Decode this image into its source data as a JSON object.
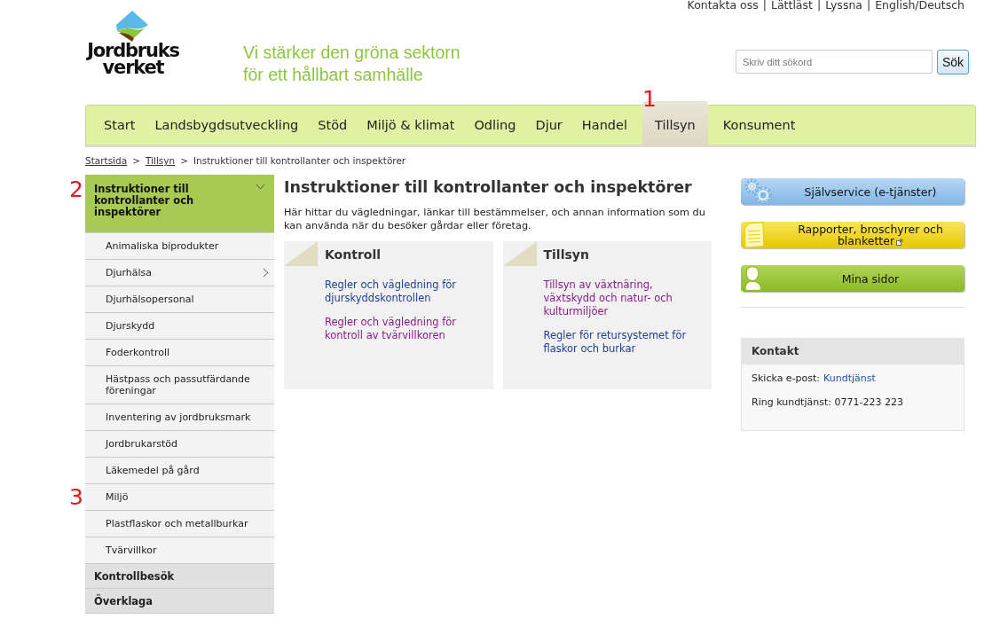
{
  "utility_links": [
    "Kontakta oss",
    "Lättläst",
    "Lyssna",
    "English/Deutsch"
  ],
  "utility_separator": "|",
  "logo": {
    "lines": [
      "Jordbruks",
      "verket"
    ]
  },
  "tagline": [
    "Vi stärker den gröna sektorn",
    "för ett hållbart samhälle"
  ],
  "search": {
    "placeholder": "Skriv ditt sökord",
    "button": "Sök"
  },
  "nav": [
    {
      "label": "Start",
      "selected": false
    },
    {
      "label": "Landsbygdsutveckling",
      "selected": false
    },
    {
      "label": "Stöd",
      "selected": false
    },
    {
      "label": "Miljö & klimat",
      "selected": false
    },
    {
      "label": "Odling",
      "selected": false
    },
    {
      "label": "Djur",
      "selected": false
    },
    {
      "label": "Handel",
      "selected": false
    },
    {
      "label": "Tillsyn",
      "selected": true,
      "annotation": "1"
    },
    {
      "label": "Konsument",
      "selected": false
    }
  ],
  "breadcrumb_separator": ">",
  "breadcrumb": [
    {
      "label": "Startsida",
      "link": true
    },
    {
      "label": "Tillsyn",
      "link": true
    },
    {
      "label": "Instruktioner till kontrollanter och inspektörer",
      "link": false
    }
  ],
  "sidebar": {
    "items": [
      {
        "label": "Instruktioner till kontrollanter och inspektörer",
        "selected": true,
        "expanded": true,
        "annotation": "2",
        "children": [
          {
            "label": "Animaliska biprodukter",
            "expandable": false
          },
          {
            "label": "Djurhälsa",
            "expandable": true
          },
          {
            "label": "Djurhälsopersonal",
            "expandable": false
          },
          {
            "label": "Djurskydd",
            "expandable": false
          },
          {
            "label": "Foderkontroll",
            "expandable": false
          },
          {
            "label": "Hästpass och passutfärdande föreningar",
            "expandable": false
          },
          {
            "label": "Inventering av jordbruksmark",
            "expandable": false
          },
          {
            "label": "Jordbrukarstöd",
            "expandable": false
          },
          {
            "label": "Läkemedel på gård",
            "expandable": false
          },
          {
            "label": "Miljö",
            "expandable": false,
            "annotation": "3"
          },
          {
            "label": "Plastflaskor och metallburkar",
            "expandable": false
          },
          {
            "label": "Tvärvillkor",
            "expandable": false
          }
        ]
      },
      {
        "label": "Kontrollbesök",
        "selected": false,
        "expanded": false
      },
      {
        "label": "Överklaga",
        "selected": false,
        "expanded": false
      }
    ]
  },
  "main": {
    "title": "Instruktioner till kontrollanter och inspektörer",
    "intro": "Här hittar du vägledningar, länkar till bestämmelser, och annan information som du kan använda när du besöker gårdar eller företag.",
    "cards": [
      {
        "title": "Kontroll",
        "links": [
          {
            "label": "Regler och vägledning för djurskyddskontrollen",
            "visited": false
          },
          {
            "label": "Regler och vägledning för kontroll av tvärvillkoren",
            "visited": true
          }
        ]
      },
      {
        "title": "Tillsyn",
        "links": [
          {
            "label": "Tillsyn av växtnäring, växtskydd och natur- och kulturmiljöer",
            "visited": true
          },
          {
            "label": "Regler för retursystemet för flaskor och burkar",
            "visited": false
          }
        ]
      }
    ]
  },
  "service_buttons": [
    {
      "label": "Självservice (e-tjänster)",
      "kind": "gears"
    },
    {
      "label": "Rapporter, broschyrer och blanketter",
      "kind": "document",
      "external": true
    },
    {
      "label": "Mina sidor",
      "kind": "person"
    }
  ],
  "contact": {
    "title": "Kontakt",
    "email_label": "Skicka e-post:",
    "email_link": "Kundtjänst",
    "phone": "Ring kundtjänst: 0771-223 223"
  }
}
